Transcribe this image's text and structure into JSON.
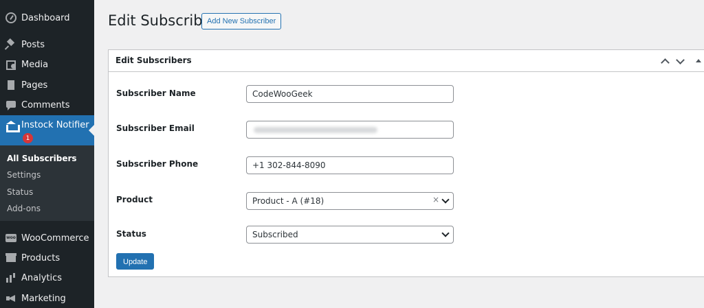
{
  "sidebar": {
    "items": [
      {
        "label": "Dashboard",
        "icon": "dashboard-icon"
      },
      {
        "label": "Posts",
        "icon": "pushpin-icon"
      },
      {
        "label": "Media",
        "icon": "media-icon"
      },
      {
        "label": "Pages",
        "icon": "pages-icon"
      },
      {
        "label": "Comments",
        "icon": "comment-icon"
      },
      {
        "label": "Instock Notifier",
        "icon": "bank-icon",
        "badge": "1",
        "active": true
      },
      {
        "label": "WooCommerce",
        "icon": "woocommerce-icon"
      },
      {
        "label": "Products",
        "icon": "box-icon"
      },
      {
        "label": "Analytics",
        "icon": "bar-chart-icon"
      },
      {
        "label": "Marketing",
        "icon": "megaphone-icon"
      }
    ],
    "submenu": [
      "All Subscribers",
      "Settings",
      "Status",
      "Add-ons"
    ],
    "accent_color": "#2271b1",
    "badge_color": "#d63638"
  },
  "header": {
    "title": "Edit Subscriber",
    "add_new_label": "Add New Subscriber"
  },
  "form": {
    "box_title": "Edit Subscribers",
    "name_label": "Subscriber Name",
    "name_value": "CodeWooGeek",
    "email_label": "Subscriber Email",
    "email_value": "",
    "phone_label": "Subscriber Phone",
    "phone_value": "+1 302-844-8090",
    "product_label": "Product",
    "product_value": "Product - A (#18)",
    "product_clear": "×",
    "status_label": "Status",
    "status_value": "Subscribed",
    "update_label": "Update"
  }
}
